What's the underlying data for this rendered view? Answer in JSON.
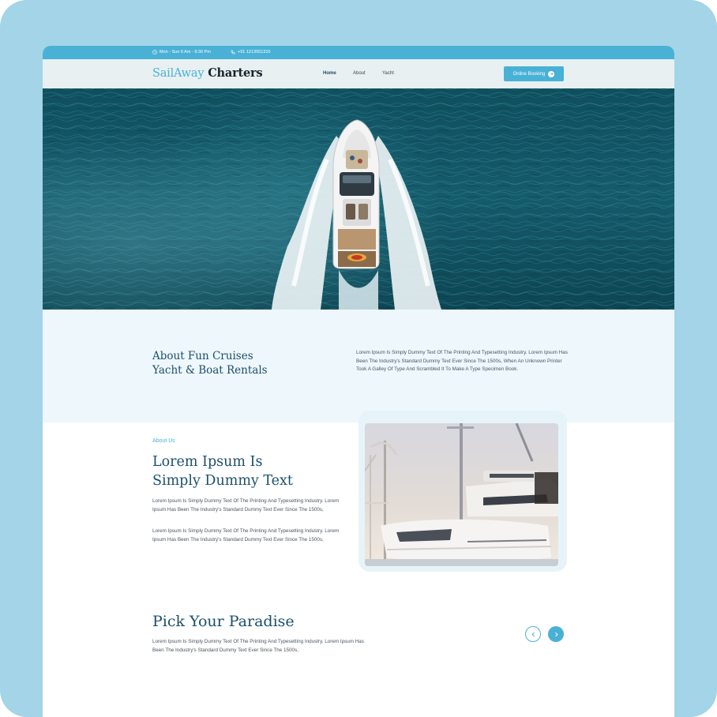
{
  "topbar": {
    "hours": "Mon - Sun 6 Am - 9:30 Pm",
    "phone": "+91 1213551310"
  },
  "header": {
    "logo_part1": "SailAway",
    "logo_part2": "Charters",
    "nav": [
      "Home",
      "About",
      "Yacht"
    ],
    "booking_label": "Online Booking"
  },
  "intro": {
    "title_line1": "About Fun Cruises",
    "title_line2": "Yacht & Boat Rentals",
    "text": "Lorem Ipsum Is Simply Dummy Text Of The Printing And Typesetting Industry. Lorem Ipsum Has Been The Industry's Standard Dummy Text Ever Since The 1500s, When An Unknown Printer Took A Galley Of Type And Scrambled It To Make A Type Specimen Book."
  },
  "about": {
    "label": "About Us",
    "title_line1": "Lorem Ipsum Is",
    "title_line2": "Simply Dummy Text",
    "p1": "Lorem Ipsum Is Simply Dummy Text Of The Printing And Typesetting Industry. Lorem Ipsum Has Been The Industry's Standard Dummy Text Ever Since The 1500s,",
    "p2": "Lorem Ipsum Is Simply Dummy Text Of The Printing And Typesetting Industry. Lorem Ipsum Has Been The Industry's Standard Dummy Text Ever Since The 1500s,"
  },
  "paradise": {
    "title": "Pick Your Paradise",
    "text": "Lorem Ipsum Is Simply Dummy Text Of The Printing And Typesetting Industry. Lorem Ipsum Has Been The Industry's Standard Dummy Text Ever Since The 1500s,"
  },
  "icons": {
    "hours": "clock-icon",
    "phone": "phone-icon",
    "booking": "arrow-right-circle-icon",
    "prev": "chevron-left-icon",
    "next": "chevron-right-icon"
  },
  "colors": {
    "accent": "#4ab1d6",
    "heading": "#1c4f6b",
    "frame": "#a3d4e7",
    "intro_bg": "#eef7fb"
  }
}
